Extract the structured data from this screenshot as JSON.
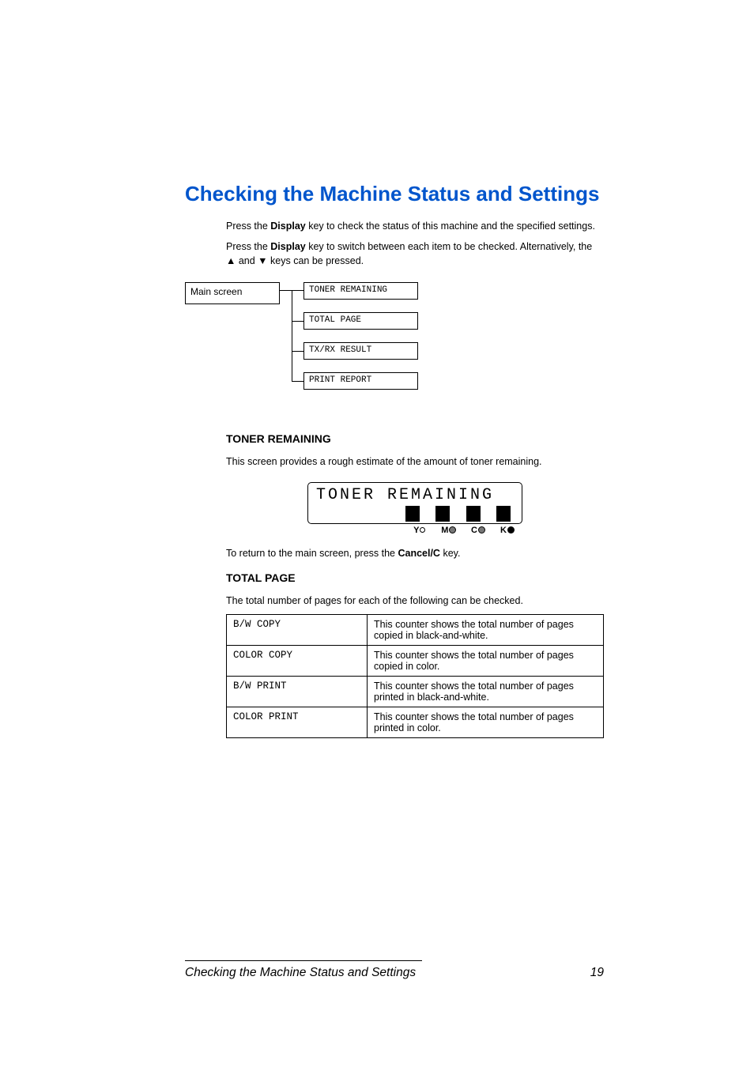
{
  "title": "Checking the Machine Status and Settings",
  "intro1_a": "Press the ",
  "intro1_key": "Display",
  "intro1_b": " key to check the status of this machine and the specified settings.",
  "intro2_a": "Press the ",
  "intro2_key": "Display",
  "intro2_b": " key to switch between each item to be checked. Alternatively, the ▲ and ▼ keys can be pressed.",
  "diagram": {
    "main": "Main screen",
    "nodes": [
      "TONER REMAINING",
      "TOTAL PAGE",
      "TX/RX RESULT",
      "PRINT REPORT"
    ]
  },
  "toner": {
    "heading": "TONER REMAINING",
    "desc": "This screen provides a rough estimate of the amount of toner remaining.",
    "lcd_text": "TONER REMAINING",
    "legend": {
      "y": "Y",
      "m": "M",
      "c": "C",
      "k": "K"
    },
    "return_a": "To return to the main screen, press the ",
    "return_key": "Cancel/C",
    "return_b": " key."
  },
  "totalpage": {
    "heading": "TOTAL PAGE",
    "desc": "The total number of pages for each of the following can be checked.",
    "rows": [
      {
        "code": "B/W COPY",
        "desc": "This counter shows the total number of pages copied in black-and-white."
      },
      {
        "code": "COLOR COPY",
        "desc": "This counter shows the total number of pages copied in color."
      },
      {
        "code": "B/W PRINT",
        "desc": "This counter shows the total number of pages printed in black-and-white."
      },
      {
        "code": "COLOR PRINT",
        "desc": "This counter shows the total number of pages printed in color."
      }
    ]
  },
  "footer": {
    "title": "Checking the Machine Status and Settings",
    "page": "19"
  }
}
